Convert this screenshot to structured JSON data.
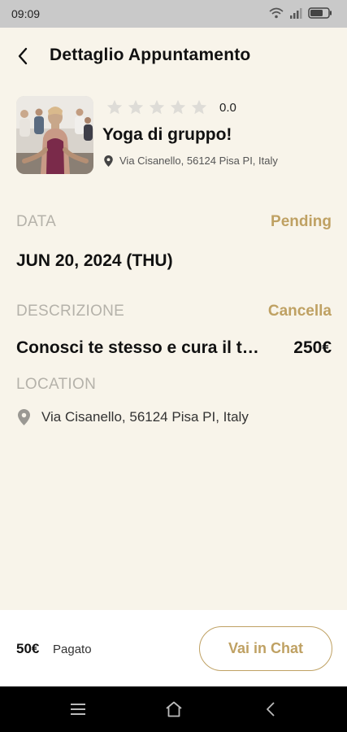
{
  "status_bar": {
    "time": "09:09"
  },
  "header": {
    "title": "Dettaglio Appuntamento"
  },
  "service": {
    "rating": 0,
    "rating_label": "0.0",
    "title": "Yoga di gruppo!",
    "address": "Via Cisanello, 56124 Pisa PI, Italy"
  },
  "date_section": {
    "label": "DATA",
    "status": "Pending",
    "value": "JUN 20, 2024 (THU)"
  },
  "description_section": {
    "label": "DESCRIZIONE",
    "action": "Cancella",
    "text": "Conosci te stesso e cura il t…",
    "price": "250€"
  },
  "location_section": {
    "label": "LOCATION",
    "address": "Via Cisanello, 56124 Pisa PI, Italy"
  },
  "footer": {
    "amount": "50€",
    "paid_label": "Pagato",
    "chat_button": "Vai in Chat"
  },
  "colors": {
    "accent": "#bfa163",
    "background": "#f8f4ea",
    "label_gray": "#b5b2aa"
  }
}
